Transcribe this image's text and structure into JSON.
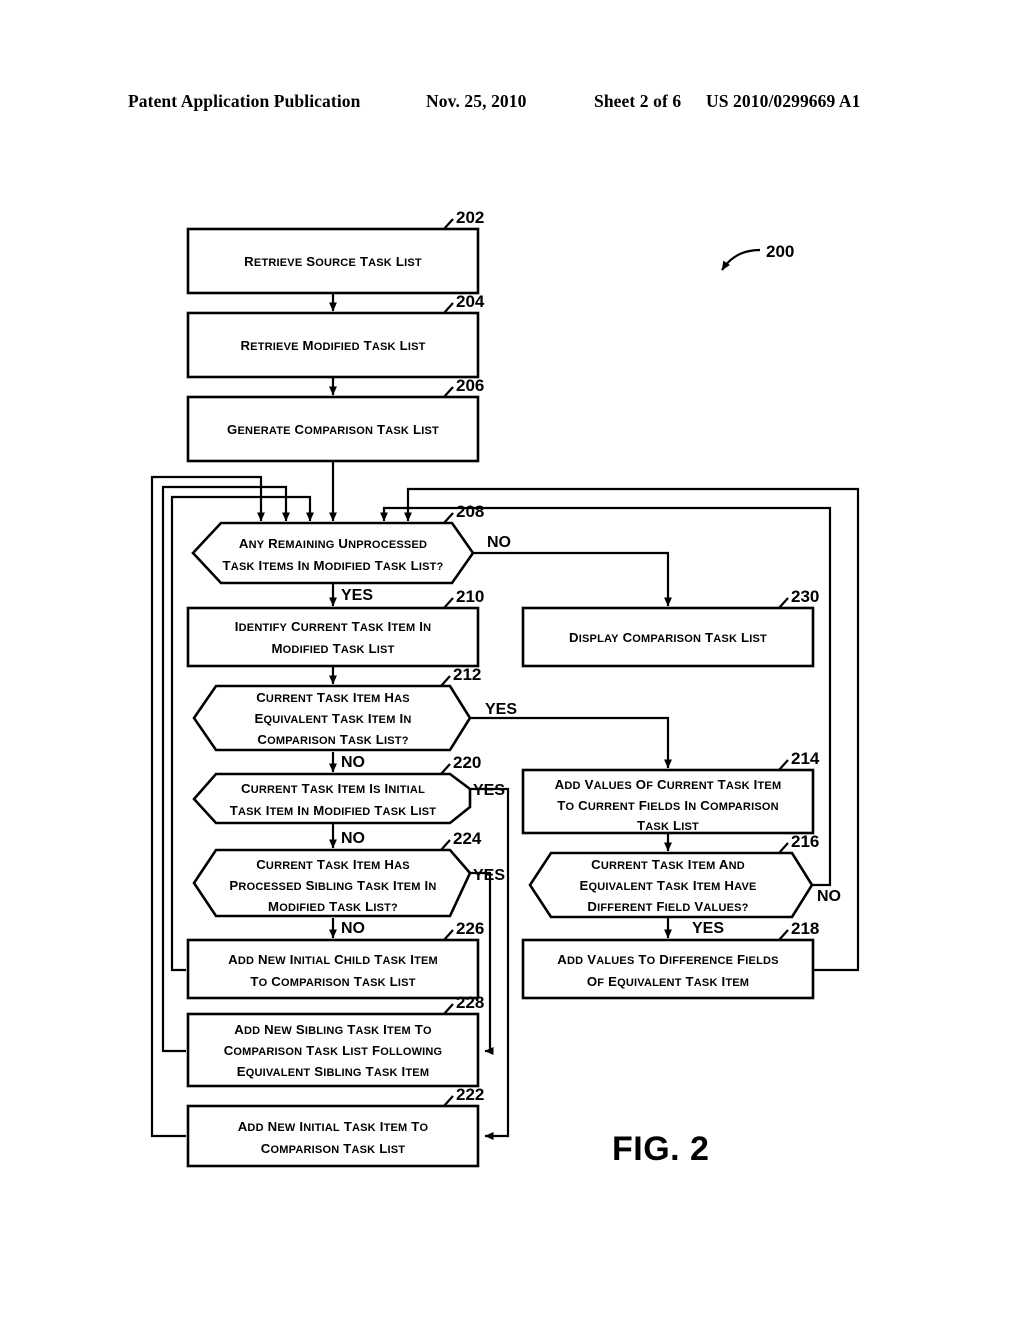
{
  "header": {
    "publication": "Patent Application Publication",
    "date": "Nov. 25, 2010",
    "sheet": "Sheet 2 of 6",
    "patent_number": "US 2010/0299669 A1"
  },
  "figure": {
    "caption": "FIG. 2",
    "diagram_reference": "200"
  },
  "chart_data": {
    "type": "flowchart",
    "title": "FIG. 2",
    "diagram_reference": "200",
    "nodes": [
      {
        "id": "202",
        "ref": "202",
        "shape": "process",
        "text": "Retrieve Source Task List"
      },
      {
        "id": "204",
        "ref": "204",
        "shape": "process",
        "text": "Retrieve Modified Task List"
      },
      {
        "id": "206",
        "ref": "206",
        "shape": "process",
        "text": "Generate Comparison Task List"
      },
      {
        "id": "208",
        "ref": "208",
        "shape": "decision",
        "text": "Any Remaining Unprocessed Task Items in Modified Task List?"
      },
      {
        "id": "210",
        "ref": "210",
        "shape": "process",
        "text": "Identify Current Task Item in Modified Task List"
      },
      {
        "id": "212",
        "ref": "212",
        "shape": "decision",
        "text": "Current Task Item Has Equivalent Task Item in Comparison Task List?"
      },
      {
        "id": "214",
        "ref": "214",
        "shape": "process",
        "text": "Add Values of Current Task Item to Current Fields In Comparison Task List"
      },
      {
        "id": "216",
        "ref": "216",
        "shape": "decision",
        "text": "Current Task Item and Equivalent Task Item Have Different Field Values?"
      },
      {
        "id": "218",
        "ref": "218",
        "shape": "process",
        "text": "Add Values to Difference Fields of Equivalent Task Item"
      },
      {
        "id": "220",
        "ref": "220",
        "shape": "decision",
        "text": "Current Task Item is Initial Task Item in Modified Task List"
      },
      {
        "id": "222",
        "ref": "222",
        "shape": "process",
        "text": "Add New Initial Task Item to Comparison Task List"
      },
      {
        "id": "224",
        "ref": "224",
        "shape": "decision",
        "text": "Current Task Item Has Processed Sibling Task Item in Modified Task List?"
      },
      {
        "id": "226",
        "ref": "226",
        "shape": "process",
        "text": "Add New Initial Child Task Item to Comparison Task List"
      },
      {
        "id": "228",
        "ref": "228",
        "shape": "process",
        "text": "Add New Sibling Task Item to Comparison Task List Following Equivalent Sibling Task Item"
      },
      {
        "id": "230",
        "ref": "230",
        "shape": "process",
        "text": "Display Comparison Task List"
      }
    ],
    "edges": [
      {
        "from": "202",
        "to": "204",
        "label": ""
      },
      {
        "from": "204",
        "to": "206",
        "label": ""
      },
      {
        "from": "206",
        "to": "208",
        "label": ""
      },
      {
        "from": "208",
        "to": "210",
        "label": "YES"
      },
      {
        "from": "208",
        "to": "230",
        "label": "NO"
      },
      {
        "from": "210",
        "to": "212",
        "label": ""
      },
      {
        "from": "212",
        "to": "214",
        "label": "YES"
      },
      {
        "from": "212",
        "to": "220",
        "label": "NO"
      },
      {
        "from": "214",
        "to": "216",
        "label": ""
      },
      {
        "from": "216",
        "to": "218",
        "label": "YES"
      },
      {
        "from": "216",
        "to": "208",
        "label": "NO"
      },
      {
        "from": "218",
        "to": "208",
        "label": ""
      },
      {
        "from": "220",
        "to": "222",
        "label": "YES"
      },
      {
        "from": "220",
        "to": "224",
        "label": "NO"
      },
      {
        "from": "222",
        "to": "208",
        "label": ""
      },
      {
        "from": "224",
        "to": "228",
        "label": "YES"
      },
      {
        "from": "224",
        "to": "226",
        "label": "NO"
      },
      {
        "from": "226",
        "to": "208",
        "label": ""
      },
      {
        "from": "228",
        "to": "208",
        "label": ""
      }
    ]
  },
  "nodes": {
    "n202": {
      "ref": "202",
      "lines": [
        "Retrieve Source Task List"
      ]
    },
    "n204": {
      "ref": "204",
      "lines": [
        "Retrieve Modified Task List"
      ]
    },
    "n206": {
      "ref": "206",
      "lines": [
        "Generate Comparison Task List"
      ]
    },
    "n208": {
      "ref": "208",
      "lines": [
        "Any Remaining Unprocessed",
        "Task Items in Modified Task List?"
      ]
    },
    "n210": {
      "ref": "210",
      "lines": [
        "Identify Current Task Item in",
        "Modified Task List"
      ]
    },
    "n212": {
      "ref": "212",
      "lines": [
        "Current Task Item Has",
        "Equivalent Task Item in",
        "Comparison Task List?"
      ]
    },
    "n214": {
      "ref": "214",
      "lines": [
        "Add Values of Current Task Item",
        "to Current Fields In Comparison",
        "Task List"
      ]
    },
    "n216": {
      "ref": "216",
      "lines": [
        "Current Task Item and",
        "Equivalent Task Item Have",
        "Different Field Values?"
      ]
    },
    "n218": {
      "ref": "218",
      "lines": [
        "Add Values to Difference Fields",
        "of Equivalent Task Item"
      ]
    },
    "n220": {
      "ref": "220",
      "lines": [
        "Current Task Item is Initial",
        "Task Item in Modified Task List"
      ]
    },
    "n222": {
      "ref": "222",
      "lines": [
        "Add New Initial Task Item to",
        "Comparison Task List"
      ]
    },
    "n224": {
      "ref": "224",
      "lines": [
        "Current Task Item Has",
        "Processed Sibling Task Item in",
        "Modified Task List?"
      ]
    },
    "n226": {
      "ref": "226",
      "lines": [
        "Add New Initial Child Task Item",
        "to Comparison Task List"
      ]
    },
    "n228": {
      "ref": "228",
      "lines": [
        "Add New Sibling Task Item to",
        "Comparison Task List Following",
        "Equivalent Sibling Task Item"
      ]
    },
    "n230": {
      "ref": "230",
      "lines": [
        "Display Comparison Task List"
      ]
    }
  },
  "branches": {
    "b208_no": "NO",
    "b208_yes": "YES",
    "b212_yes": "YES",
    "b212_no": "NO",
    "b216_no": "NO",
    "b216_yes": "YES",
    "b220_yes": "YES",
    "b220_no": "NO",
    "b224_yes": "YES",
    "b224_no": "NO"
  }
}
